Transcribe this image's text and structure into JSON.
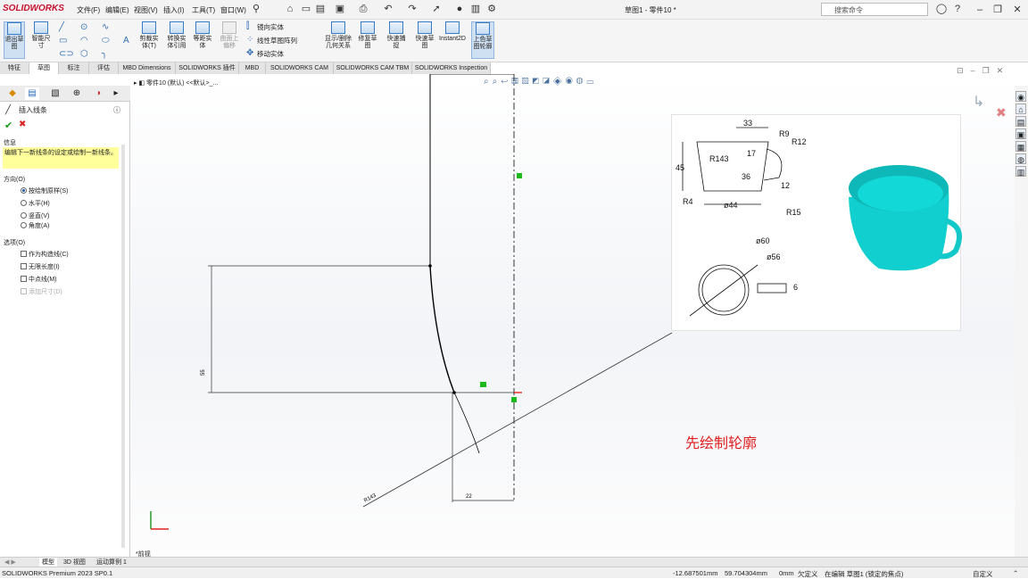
{
  "app": {
    "logo": "SOLIDWORKS",
    "doc_title": "草图1 - 零件10 *"
  },
  "menu": [
    "文件(F)",
    "编辑(E)",
    "视图(V)",
    "插入(I)",
    "工具(T)",
    "窗口(W)"
  ],
  "search": {
    "placeholder": "搜索命令"
  },
  "ribbon": {
    "exit_sketch": "退出草图",
    "smart_dimension": "智能尺寸",
    "trim": "剪裁实体(T)",
    "convert": "转换实体引用",
    "offset": "等距实体",
    "surface_offset": "曲面上偏移",
    "mirror": "镜向实体",
    "linear_pattern": "线性草图阵列",
    "move": "移动实体",
    "display_relations": "显示/删除几何关系",
    "repair": "修复草图",
    "quick_snap": "快速捕捉",
    "rapid_sketch": "快速草图",
    "instant2d": "Instant2D",
    "shaded_sketch": "上色草图轮廓"
  },
  "cmd_tabs": [
    "特征",
    "草图",
    "标注",
    "评估",
    "MBD Dimensions",
    "SOLIDWORKS 插件",
    "MBD",
    "SOLIDWORKS CAM",
    "SOLIDWORKS CAM TBM",
    "SOLIDWORKS Inspection"
  ],
  "active_tab_index": 1,
  "tree_breadcrumb": "零件10 (默认) <<默认>_...",
  "panel": {
    "title": "插入线条",
    "message_header": "信息",
    "message": "编辑下一新线条的设定或绘制一新线条。",
    "direction_header": "方向(O)",
    "directions": [
      "按绘制原样(S)",
      "水平(H)",
      "竖直(V)",
      "角度(A)"
    ],
    "selected_direction": 0,
    "options_header": "选项(O)",
    "options": [
      "作为构造线(C)",
      "无限长度(I)",
      "中点线(M)",
      "添加尺寸(D)"
    ]
  },
  "reference_image": {
    "dims": [
      "33",
      "R9",
      "R12",
      "17",
      "45",
      "R143",
      "36",
      "12",
      "R4",
      "ø44",
      "R15",
      "ø60",
      "ø56",
      "6"
    ]
  },
  "sketch": {
    "dim_left": "55",
    "dim_bottom": "22",
    "dim_diag": "R143"
  },
  "annotation": "先绘制轮廓",
  "view_label": "*前视",
  "bottom_tabs": [
    "模型",
    "3D 视图",
    "运动算例 1"
  ],
  "status": {
    "product": "SOLIDWORKS Premium 2023 SP0.1",
    "x": "-12.687501mm",
    "y": "59.704304mm",
    "z": "0mm",
    "defined": "欠定义",
    "editing": "在编辑 草图1 (锁定的焦点)",
    "units": "自定义"
  }
}
